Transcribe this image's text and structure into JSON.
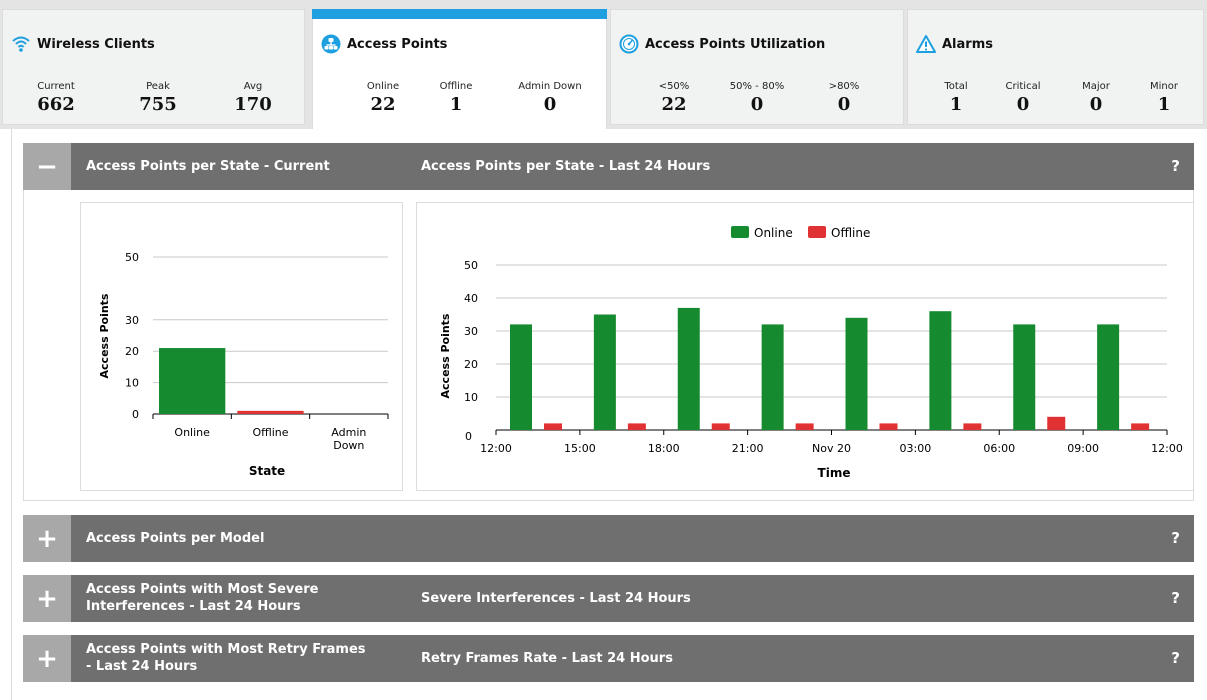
{
  "tiles": {
    "wireless_clients": {
      "title": "Wireless Clients",
      "icon": "wifi-icon",
      "metrics": [
        {
          "label": "Current",
          "value": "662"
        },
        {
          "label": "Peak",
          "value": "755"
        },
        {
          "label": "Avg",
          "value": "170"
        }
      ]
    },
    "access_points": {
      "title": "Access Points",
      "icon": "access-point-icon",
      "metrics": [
        {
          "label": "Online",
          "value": "22"
        },
        {
          "label": "Offline",
          "value": "1"
        },
        {
          "label": "Admin Down",
          "value": "0"
        }
      ]
    },
    "utilization": {
      "title": "Access Points Utilization",
      "icon": "gauge-icon",
      "metrics": [
        {
          "label": "<50%",
          "value": "22"
        },
        {
          "label": "50% - 80%",
          "value": "0"
        },
        {
          "label": ">80%",
          "value": "0"
        }
      ]
    },
    "alarms": {
      "title": "Alarms",
      "icon": "warning-icon",
      "metrics": [
        {
          "label": "Total",
          "value": "1"
        },
        {
          "label": "Critical",
          "value": "0"
        },
        {
          "label": "Major",
          "value": "0"
        },
        {
          "label": "Minor",
          "value": "1"
        }
      ]
    }
  },
  "panels": {
    "state": {
      "toggle": "−",
      "title": "Access Points per State - Current",
      "title2": "Access Points per State - Last 24 Hours",
      "help": "?"
    },
    "model": {
      "toggle": "+",
      "title": "Access Points per Model",
      "help": "?"
    },
    "interference": {
      "toggle": "+",
      "title_line1": "Access Points with Most Severe",
      "title_line2": "Interferences - Last 24 Hours",
      "title2": "Severe Interferences - Last 24 Hours",
      "help": "?"
    },
    "retry": {
      "toggle": "+",
      "title_line1": "Access Points with Most Retry Frames",
      "title_line2": "- Last 24 Hours",
      "title2": "Retry Frames Rate - Last 24 Hours",
      "help": "?"
    }
  },
  "colors": {
    "online": "#168a2f",
    "offline": "#e03232",
    "accent": "#1e9fe0",
    "bar": "#6f6f6f"
  },
  "chart_data": [
    {
      "type": "bar",
      "categories": [
        "Online",
        "Offline",
        "Admin Down"
      ],
      "values": [
        21,
        1,
        0
      ],
      "xlabel": "State",
      "ylabel": "Access Points",
      "yticks": [
        0,
        10,
        20,
        30,
        50
      ],
      "ylim": [
        0,
        50
      ],
      "grid": true
    },
    {
      "type": "bar",
      "x": [
        "12:00",
        "15:00",
        "18:00",
        "21:00",
        "Nov 20",
        "03:00",
        "06:00",
        "09:00",
        "12:00"
      ],
      "series": [
        {
          "name": "Online",
          "values": [
            32,
            35,
            37,
            32,
            34,
            36,
            32,
            32
          ]
        },
        {
          "name": "Offline",
          "values": [
            2,
            2,
            2,
            2,
            2,
            2,
            4,
            2
          ]
        }
      ],
      "xlabel": "Time",
      "ylabel": "Access Points",
      "yticks": [
        0,
        10,
        20,
        30,
        40,
        50
      ],
      "ylim": [
        0,
        50
      ],
      "legend": "top-center",
      "grid": true
    }
  ]
}
